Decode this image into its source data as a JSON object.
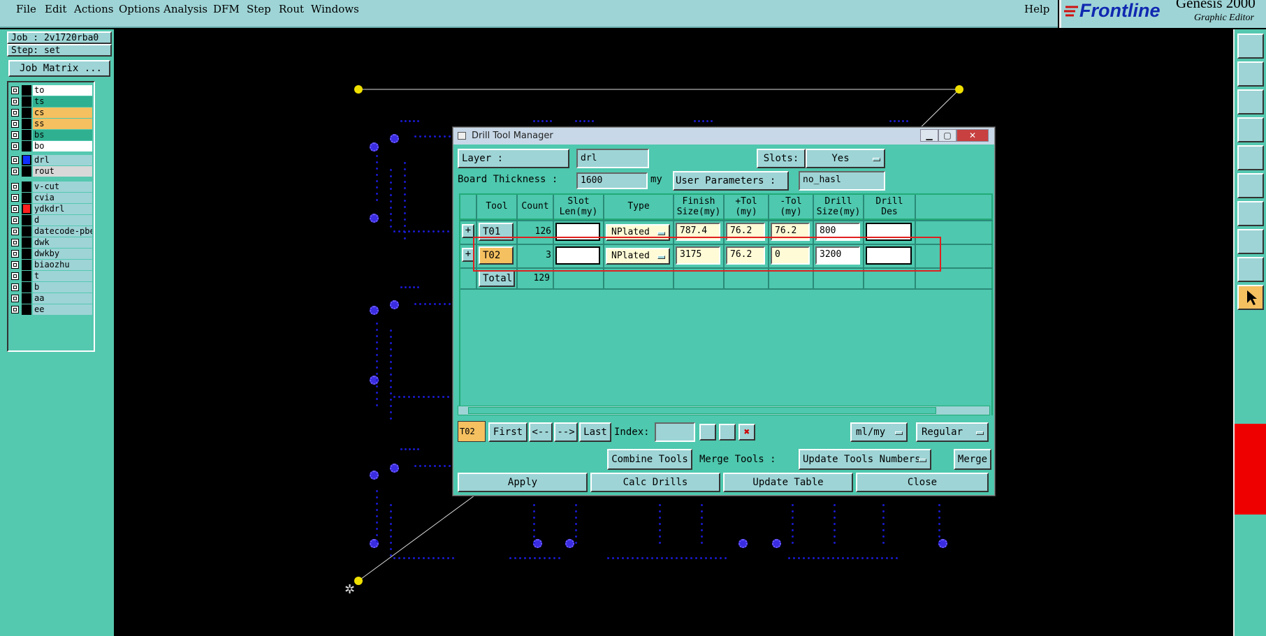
{
  "menu": {
    "items": [
      "File",
      "Edit",
      "Actions",
      "Options",
      "Analysis",
      "DFM",
      "Step",
      "Rout",
      "Windows"
    ],
    "help": "Help"
  },
  "brand": {
    "logo": "Frontline",
    "product": "Genesis 2000",
    "subtitle": "Graphic Editor"
  },
  "left": {
    "job": "Job : 2v1720rba0",
    "step": "Step: set",
    "job_matrix": "Job Matrix ...",
    "layers_group1": [
      {
        "name": "to",
        "color": "#ffffff"
      },
      {
        "name": "ts",
        "color": "#2fb090"
      },
      {
        "name": "cs",
        "color": "#f5c060"
      },
      {
        "name": "ss",
        "color": "#f5c060"
      },
      {
        "name": "bs",
        "color": "#2fb090"
      },
      {
        "name": "bo",
        "color": "#ffffff"
      }
    ],
    "layers_group2": [
      {
        "name": "drl",
        "color": "#9ed4d6",
        "swatch": "#1030ff"
      },
      {
        "name": "rout",
        "color": "#d8d8d8"
      }
    ],
    "layers_group3": [
      {
        "name": "v-cut"
      },
      {
        "name": "cvia"
      },
      {
        "name": "ydkdrl",
        "swatch": "#ff2020"
      },
      {
        "name": "d"
      },
      {
        "name": "datecode-pbe"
      },
      {
        "name": "dwk"
      },
      {
        "name": "dwkby"
      },
      {
        "name": "biaozhu"
      },
      {
        "name": "t"
      },
      {
        "name": "b"
      },
      {
        "name": "aa"
      },
      {
        "name": "ee"
      }
    ]
  },
  "dialog": {
    "title": "Drill Tool Manager",
    "window_buttons": {
      "minimize": "▁",
      "maximize": "▢",
      "close": "✕"
    },
    "layer_label": "Layer          :",
    "layer_value": "drl",
    "slots_label": "Slots:",
    "slots_value": "Yes",
    "thickness_label": "Board Thickness :",
    "thickness_value": "1600",
    "thickness_unit": "my",
    "user_params_label": "User Parameters :",
    "user_params_value": "no_hasl",
    "columns": [
      {
        "l1": "Tool",
        "l2": ""
      },
      {
        "l1": "Count",
        "l2": ""
      },
      {
        "l1": "Slot",
        "l2": "Len(my)"
      },
      {
        "l1": "Type",
        "l2": ""
      },
      {
        "l1": "Finish",
        "l2": "Size(my)"
      },
      {
        "l1": "+Tol",
        "l2": "(my)"
      },
      {
        "l1": "-Tol",
        "l2": "(my)"
      },
      {
        "l1": "Drill",
        "l2": "Size(my)"
      },
      {
        "l1": "Drill",
        "l2": "Des"
      }
    ],
    "rows": [
      {
        "tool": "T01",
        "count": "126",
        "slot": "",
        "type": "NPlated",
        "finish": "787.4",
        "ptol": "76.2",
        "ntol": "76.2",
        "drill": "800",
        "des": ""
      },
      {
        "tool": "T02",
        "count": "3",
        "slot": "",
        "type": "NPlated",
        "finish": "3175",
        "ptol": "76.2",
        "ntol": "0",
        "drill": "3200",
        "des": ""
      }
    ],
    "total_label": "Total",
    "total_count": "129",
    "nav": {
      "current": "T02",
      "first": "First",
      "prev": "<--",
      "next": "-->",
      "last": "Last",
      "index_label": "Index:",
      "index_value": "",
      "units": "ml/my",
      "mode": "Regular"
    },
    "combine_tools": "Combine Tools",
    "merge_tools_label": "Merge Tools :",
    "merge_tools_value": "Update Tools Numbers",
    "merge": "Merge",
    "apply": "Apply",
    "calc_drills": "Calc Drills",
    "update_table": "Update Table",
    "close": "Close"
  },
  "colors": {
    "panel": "#55c8b0",
    "light": "#9ed4d6",
    "highlight": "#f5c060",
    "dialog_bg": "#4ec8ae",
    "selection_box": "#e02020"
  }
}
